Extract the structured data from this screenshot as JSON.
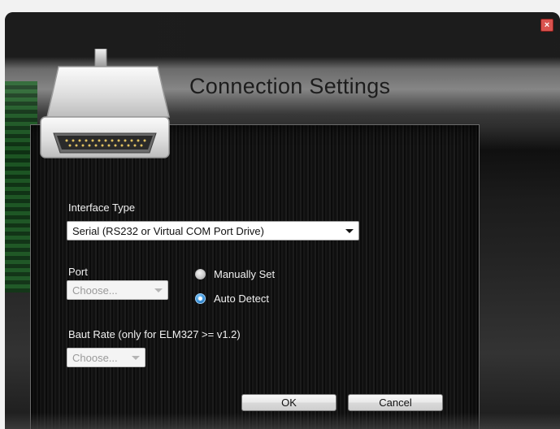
{
  "window": {
    "title": "Connection Settings",
    "close_icon": "close-icon"
  },
  "icons": {
    "connector": "serial-connector-icon"
  },
  "interface": {
    "label": "Interface Type",
    "value": "Serial (RS232 or Virtual COM Port Drive)"
  },
  "port": {
    "label": "Port",
    "value": "Choose...",
    "radios": [
      {
        "label": "Manually Set",
        "checked": false
      },
      {
        "label": "Auto Detect",
        "checked": true
      }
    ]
  },
  "baud": {
    "label": "Baut Rate (only for ELM327 >= v1.2)",
    "value": "Choose..."
  },
  "buttons": {
    "ok": "OK",
    "cancel": "Cancel"
  },
  "colors": {
    "radio_checked": "#3c92d8",
    "close_button": "#d9534f"
  }
}
